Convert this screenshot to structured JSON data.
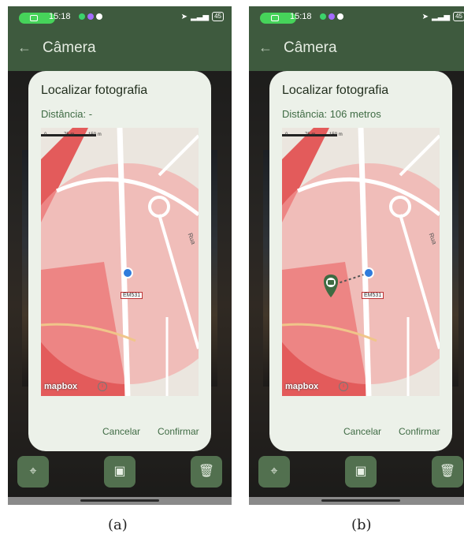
{
  "panels": [
    {
      "caption": "(a)",
      "status": {
        "time": "15:18",
        "battery": "45"
      },
      "appbar": {
        "back_icon": "arrow-left-icon",
        "title": "Câmera"
      },
      "dialog": {
        "title": "Localizar fotografia",
        "distance": "Distância: -",
        "map": {
          "road_label": "EM531",
          "street_label": "Rua",
          "attribution": "mapbox",
          "scale_labels": [
            "0",
            "75 m",
            "150 m"
          ],
          "photo_marker_visible": false
        },
        "cancel": "Cancelar",
        "confirm": "Confirmar"
      }
    },
    {
      "caption": "(b)",
      "status": {
        "time": "15:18",
        "battery": "45"
      },
      "appbar": {
        "back_icon": "arrow-left-icon",
        "title": "Câmera"
      },
      "dialog": {
        "title": "Localizar fotografia",
        "distance": "Distância: 106 metros",
        "map": {
          "road_label": "EM531",
          "street_label": "Rua",
          "attribution": "mapbox",
          "scale_labels": [
            "0",
            "75 m",
            "150 m"
          ],
          "photo_marker_visible": true
        },
        "cancel": "Cancelar",
        "confirm": "Confirmar"
      }
    }
  ],
  "colors": {
    "appbar": "#3e5a3e",
    "accent": "#3f6b44",
    "circle": "#f3a2a0",
    "zone": "#e35b5b"
  }
}
